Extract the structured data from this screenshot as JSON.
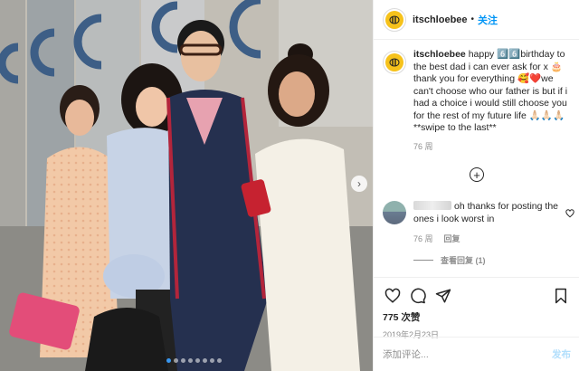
{
  "post": {
    "username": "itschloebee",
    "separator": "•",
    "follow_label": "关注",
    "caption": {
      "username": "itschloebee",
      "text": "happy 6️⃣6️⃣birthday to the best dad i can ever ask for x 🎂 thank you for everything 🥰❤️we can't choose who our father is but if i had a choice i would still choose you for the rest of my future life 🙏🏻🙏🏻🙏🏻 **swipe to the last**",
      "time": "76 周"
    },
    "load_more_label": "+",
    "comment": {
      "text": "oh thanks for posting the ones i look worst in",
      "time": "76 周",
      "reply_label": "回复",
      "view_replies_label": "查看回复 (1)"
    },
    "likes_label": "775 次赞",
    "date_label": "2019年2月23日",
    "comment_input_placeholder": "添加评论...",
    "post_button_label": "发布"
  },
  "carousel": {
    "total_slides": 8,
    "active_slide": 1,
    "next_arrow": "›"
  },
  "icons": {
    "header_avatar": "bee-avatar-icon",
    "like": "heart-icon",
    "comment": "comment-bubble-icon",
    "share": "paper-plane-icon",
    "save": "bookmark-icon",
    "comment_like": "small-heart-icon",
    "load_more": "plus-circle-icon"
  },
  "colors": {
    "accent": "#0095f6",
    "post_button_disabled": "#b2dffc",
    "muted_text": "#8e8e8e",
    "text": "#262626",
    "carousel_active_dot": "#3897f0"
  }
}
